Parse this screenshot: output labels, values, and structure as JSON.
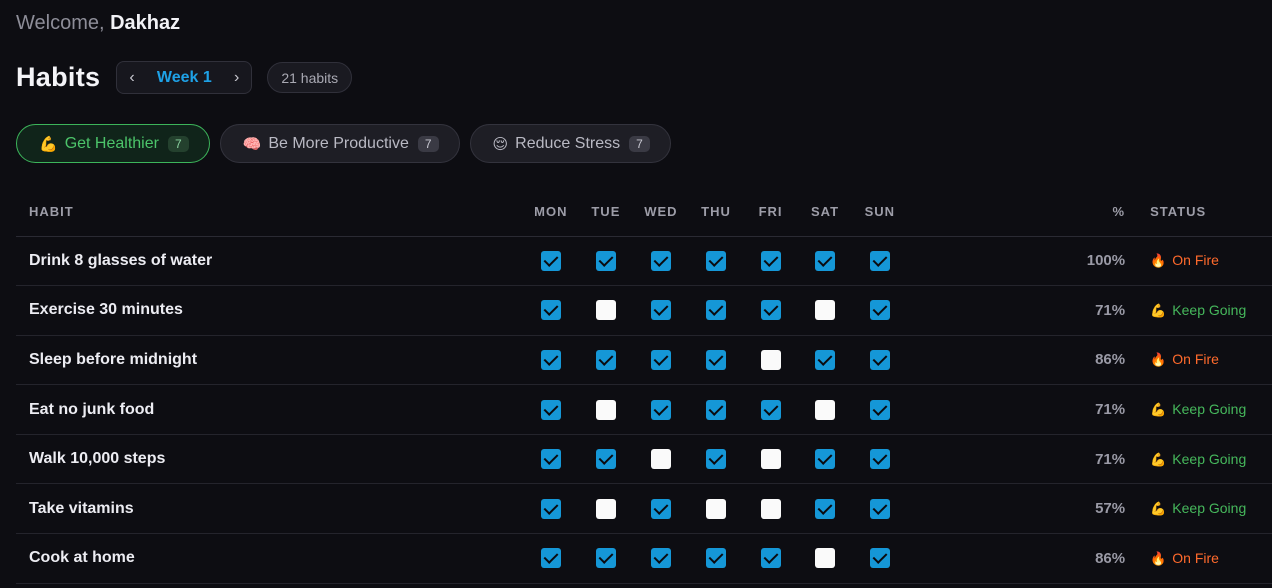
{
  "welcome": {
    "prefix": "Welcome, ",
    "user": "Dakhaz"
  },
  "header": {
    "title": "Habits",
    "week_label": "Week 1",
    "habit_count": "21 habits"
  },
  "categories": [
    {
      "emoji": "💪",
      "label": "Get Healthier",
      "count": "7",
      "active": true
    },
    {
      "emoji": "🧠",
      "label": "Be More Productive",
      "count": "7",
      "active": false
    },
    {
      "emoji": "😌",
      "label": "Reduce Stress",
      "count": "7",
      "active": false
    }
  ],
  "table": {
    "columns": [
      "HABIT",
      "MON",
      "TUE",
      "WED",
      "THU",
      "FRI",
      "SAT",
      "SUN",
      "%",
      "STATUS"
    ],
    "rows": [
      {
        "habit": "Drink 8 glasses of water",
        "days": [
          true,
          true,
          true,
          true,
          true,
          true,
          true
        ],
        "pct": "100%",
        "status": "On Fire"
      },
      {
        "habit": "Exercise 30 minutes",
        "days": [
          true,
          false,
          true,
          true,
          true,
          false,
          true
        ],
        "pct": "71%",
        "status": "Keep Going"
      },
      {
        "habit": "Sleep before midnight",
        "days": [
          true,
          true,
          true,
          true,
          false,
          true,
          true
        ],
        "pct": "86%",
        "status": "On Fire"
      },
      {
        "habit": "Eat no junk food",
        "days": [
          true,
          false,
          true,
          true,
          true,
          false,
          true
        ],
        "pct": "71%",
        "status": "Keep Going"
      },
      {
        "habit": "Walk 10,000 steps",
        "days": [
          true,
          true,
          false,
          true,
          false,
          true,
          true
        ],
        "pct": "71%",
        "status": "Keep Going"
      },
      {
        "habit": "Take vitamins",
        "days": [
          true,
          false,
          true,
          false,
          false,
          true,
          true
        ],
        "pct": "57%",
        "status": "Keep Going"
      },
      {
        "habit": "Cook at home",
        "days": [
          true,
          true,
          true,
          true,
          true,
          false,
          true
        ],
        "pct": "86%",
        "status": "On Fire"
      }
    ]
  },
  "status_styles": {
    "On Fire": {
      "emoji": "🔥",
      "icon": "fire-icon",
      "color": "#ff6a2c"
    },
    "Keep Going": {
      "emoji": "💪",
      "icon": "flexed-arm-icon",
      "color": "#46b85c"
    }
  },
  "colors": {
    "accent": "#1ea1e6",
    "checkbox_on": "#1597d7",
    "active_category": "#4cc46a"
  }
}
